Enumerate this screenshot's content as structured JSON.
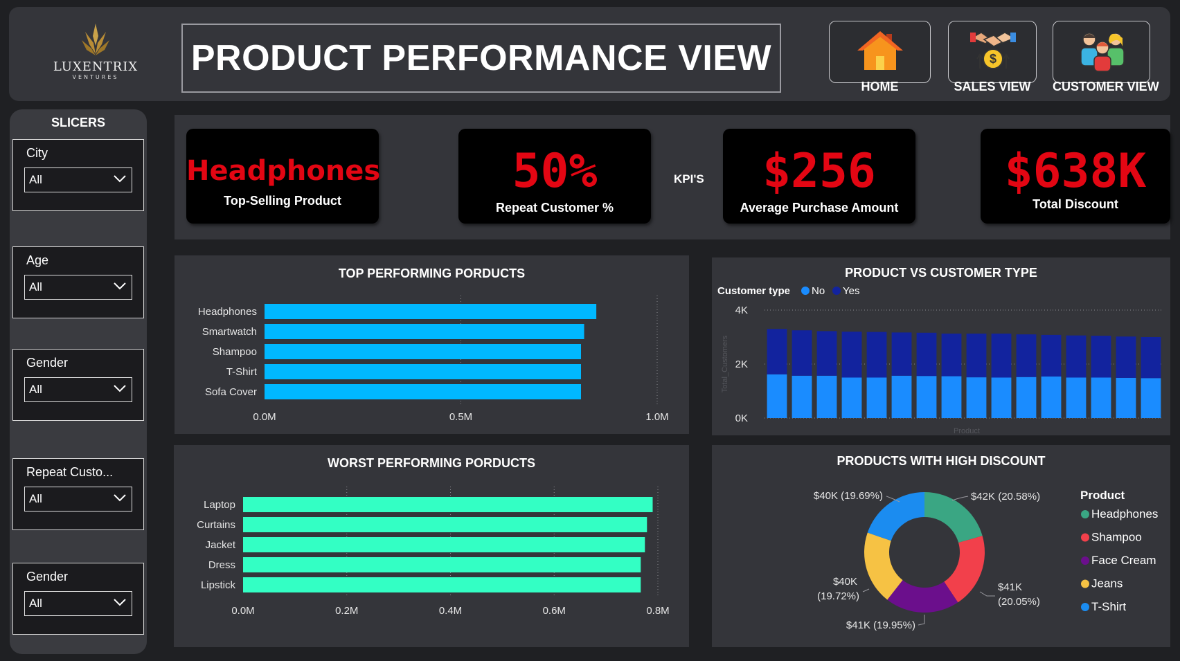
{
  "header": {
    "logo": {
      "name": "LUXENTRIX",
      "sub": "VENTURES"
    },
    "title": "PRODUCT PERFORMANCE VIEW",
    "nav": [
      {
        "label": "HOME",
        "icon": "home-icon"
      },
      {
        "label": "SALES  VIEW",
        "icon": "handshake-icon"
      },
      {
        "label": "CUSTOMER VIEW",
        "icon": "customers-icon"
      }
    ]
  },
  "slicers": {
    "title": "SLICERS",
    "items": [
      {
        "label": "City",
        "value": "All"
      },
      {
        "label": "Age",
        "value": "All"
      },
      {
        "label": "Gender",
        "value": "All"
      },
      {
        "label": "Repeat Custo...",
        "value": "All"
      },
      {
        "label": "Gender",
        "value": "All"
      }
    ]
  },
  "kpis": {
    "tag": "KPI'S",
    "items": [
      {
        "value": "Headphones",
        "label": "Top-Selling Product"
      },
      {
        "value": "50%",
        "label": "Repeat Customer %"
      },
      {
        "value": "$256",
        "label": "Average Purchase Amount"
      },
      {
        "value": "$638K",
        "label": "Total Discount"
      }
    ]
  },
  "colors": {
    "kpi_red": "#e30613",
    "top_bar": "#00b8ff",
    "worst_bar": "#33ffc4",
    "no": "#1a8cff",
    "yes": "#12239e"
  },
  "chart_data": [
    {
      "id": "top",
      "type": "bar",
      "orientation": "horizontal",
      "title": "TOP PERFORMING PORDUCTS",
      "categories": [
        "Headphones",
        "Smartwatch",
        "Shampoo",
        "T-Shirt",
        "Sofa Cover"
      ],
      "values": [
        0.845,
        0.814,
        0.806,
        0.806,
        0.806
      ],
      "xlim": [
        0,
        1.0
      ],
      "ticks": [
        0,
        0.5,
        1.0
      ],
      "tick_labels": [
        "0.0M",
        "0.5M",
        "1.0M"
      ]
    },
    {
      "id": "worst",
      "type": "bar",
      "orientation": "horizontal",
      "title": "WORST PERFORMING PORDUCTS",
      "categories": [
        "Laptop",
        "Curtains",
        "Jacket",
        "Dress",
        "Lipstick"
      ],
      "values": [
        0.79,
        0.779,
        0.775,
        0.767,
        0.767
      ],
      "xlim": [
        0,
        0.8
      ],
      "ticks": [
        0,
        0.2,
        0.4,
        0.6,
        0.8
      ],
      "tick_labels": [
        "0.0M",
        "0.2M",
        "0.4M",
        "0.6M",
        "0.8M"
      ]
    },
    {
      "id": "stack",
      "type": "bar",
      "stacked": true,
      "title": "PRODUCT VS CUSTOMER TYPE",
      "legend_title": "Customer type",
      "xlabel": "Product",
      "ylabel": "Total_Customers",
      "ylim": [
        0,
        4000
      ],
      "ticks": [
        0,
        2000,
        4000
      ],
      "tick_labels": [
        "0K",
        "2K",
        "4K"
      ],
      "series": [
        {
          "name": "No",
          "values": [
            1620,
            1570,
            1570,
            1500,
            1500,
            1570,
            1560,
            1550,
            1510,
            1500,
            1520,
            1540,
            1500,
            1500,
            1490,
            1480
          ]
        },
        {
          "name": "Yes",
          "values": [
            1680,
            1680,
            1650,
            1700,
            1690,
            1600,
            1600,
            1580,
            1620,
            1630,
            1580,
            1540,
            1560,
            1550,
            1530,
            1520
          ]
        }
      ]
    },
    {
      "id": "donut",
      "type": "pie",
      "title": "PRODUCTS WITH HIGH DISCOUNT",
      "legend_title": "Product",
      "slices": [
        {
          "name": "Headphones",
          "value": 20.58,
          "label": "$42K (20.58%)",
          "color": "#3aa683"
        },
        {
          "name": "Shampoo",
          "value": 20.05,
          "label_l1": "$41K",
          "label_l2": "(20.05%)",
          "color": "#f2404b"
        },
        {
          "name": "Face Cream",
          "value": 19.95,
          "label": "$41K (19.95%)",
          "color": "#6b0f8c"
        },
        {
          "name": "Jeans",
          "value": 19.72,
          "label_l1": "$40K",
          "label_l2": "(19.72%)",
          "color": "#f6c244"
        },
        {
          "name": "T-Shirt",
          "value": 19.69,
          "label": "$40K (19.69%)",
          "color": "#1b8cf0"
        }
      ]
    }
  ]
}
